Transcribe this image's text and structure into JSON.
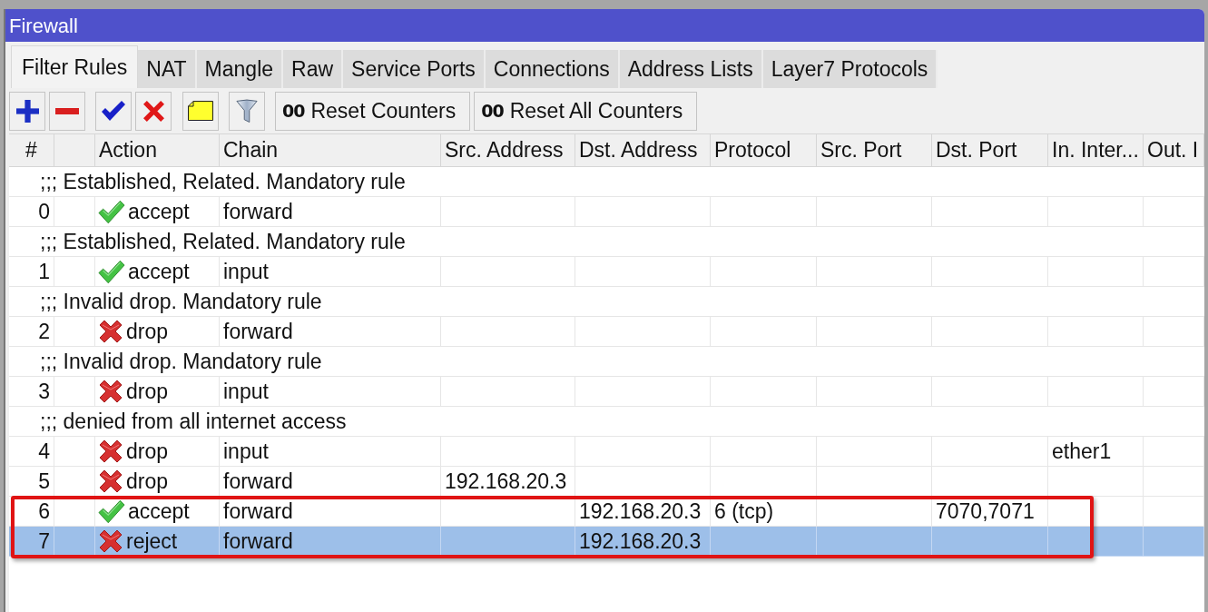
{
  "window": {
    "title": "Firewall"
  },
  "tabs": [
    {
      "label": "Filter Rules",
      "selected": true
    },
    {
      "label": "NAT",
      "selected": false
    },
    {
      "label": "Mangle",
      "selected": false
    },
    {
      "label": "Raw",
      "selected": false
    },
    {
      "label": "Service Ports",
      "selected": false
    },
    {
      "label": "Connections",
      "selected": false
    },
    {
      "label": "Address Lists",
      "selected": false
    },
    {
      "label": "Layer7 Protocols",
      "selected": false
    }
  ],
  "toolbar": {
    "counter_buttons": [
      {
        "digits": "00",
        "label": "Reset Counters"
      },
      {
        "digits": "00",
        "label": "Reset All Counters"
      }
    ]
  },
  "table": {
    "columns": [
      "#",
      "Action",
      "Chain",
      "Src. Address",
      "Dst. Address",
      "Protocol",
      "Src. Port",
      "Dst. Port",
      "In. Inter...",
      "Out. I"
    ],
    "rows": [
      {
        "kind": "comment",
        "text": ";;; Established, Related. Mandatory rule",
        "selected": false,
        "highlighted": false
      },
      {
        "kind": "rule",
        "number": "0",
        "allowed": true,
        "action": "accept",
        "chain": "forward",
        "selected": false,
        "highlighted": false
      },
      {
        "kind": "comment",
        "text": ";;; Established, Related. Mandatory rule",
        "selected": false,
        "highlighted": false
      },
      {
        "kind": "rule",
        "number": "1",
        "allowed": true,
        "action": "accept",
        "chain": "input",
        "selected": false,
        "highlighted": false
      },
      {
        "kind": "comment",
        "text": ";;; Invalid drop. Mandatory rule",
        "selected": false,
        "highlighted": false
      },
      {
        "kind": "rule",
        "number": "2",
        "allowed": false,
        "action": "drop",
        "chain": "forward",
        "selected": false,
        "highlighted": false
      },
      {
        "kind": "comment",
        "text": ";;; Invalid drop. Mandatory rule",
        "selected": false,
        "highlighted": false
      },
      {
        "kind": "rule",
        "number": "3",
        "allowed": false,
        "action": "drop",
        "chain": "input",
        "selected": false,
        "highlighted": false
      },
      {
        "kind": "comment",
        "text": ";;; denied from all internet access",
        "selected": false,
        "highlighted": false
      },
      {
        "kind": "rule",
        "number": "4",
        "allowed": false,
        "action": "drop",
        "chain": "input",
        "in_interface": "ether1",
        "selected": false,
        "highlighted": false
      },
      {
        "kind": "rule",
        "number": "5",
        "allowed": false,
        "action": "drop",
        "chain": "forward",
        "src_address": "192.168.20.3",
        "selected": false,
        "highlighted": false
      },
      {
        "kind": "rule",
        "number": "6",
        "allowed": true,
        "action": "accept",
        "chain": "forward",
        "dst_address": "192.168.20.3",
        "protocol": "6 (tcp)",
        "dst_port": "7070,7071",
        "selected": false,
        "highlighted": true
      },
      {
        "kind": "rule",
        "number": "7",
        "allowed": false,
        "action": "reject",
        "chain": "forward",
        "dst_address": "192.168.20.3",
        "selected": true,
        "highlighted": true
      }
    ]
  }
}
